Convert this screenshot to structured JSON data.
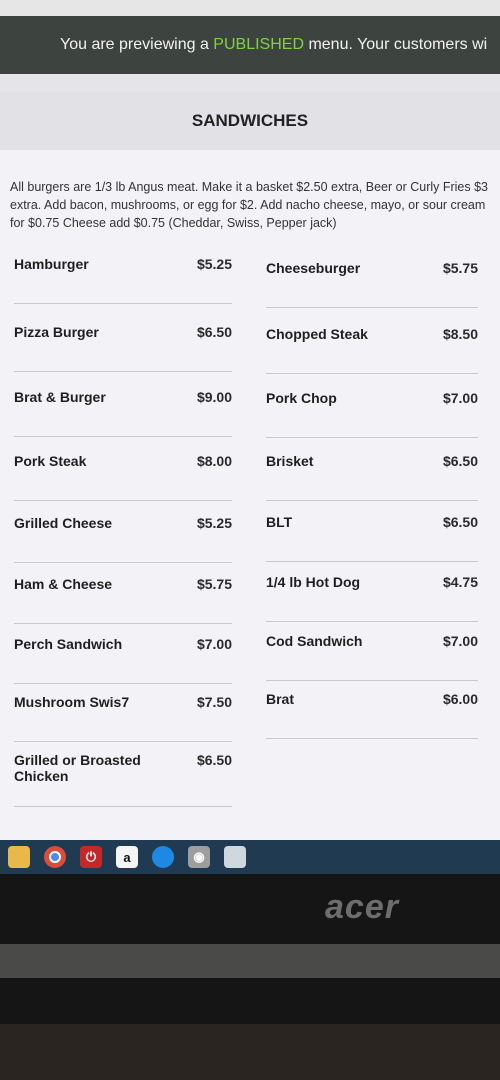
{
  "banner": {
    "prefix": "You are previewing a ",
    "highlight": "PUBLISHED",
    "suffix": " menu. Your customers wi"
  },
  "section": {
    "title": "SANDWICHES",
    "description": "All burgers are 1/3 lb Angus meat. Make it a basket $2.50 extra, Beer or Curly Fries $3 extra. Add bacon, mushrooms, or egg for $2. Add nacho cheese, mayo, or sour cream for $0.75 Cheese add $0.75 (Cheddar, Swiss, Pepper jack)"
  },
  "items": [
    {
      "name": "Hamburger",
      "price": "$5.25"
    },
    {
      "name": "Cheeseburger",
      "price": "$5.75"
    },
    {
      "name": "Pizza Burger",
      "price": "$6.50"
    },
    {
      "name": "Chopped Steak",
      "price": "$8.50"
    },
    {
      "name": "Brat & Burger",
      "price": "$9.00"
    },
    {
      "name": "Pork Chop",
      "price": "$7.00"
    },
    {
      "name": "Pork Steak",
      "price": "$8.00"
    },
    {
      "name": "Brisket",
      "price": "$6.50"
    },
    {
      "name": "Grilled Cheese",
      "price": "$5.25"
    },
    {
      "name": "BLT",
      "price": "$6.50"
    },
    {
      "name": "Ham & Cheese",
      "price": "$5.75"
    },
    {
      "name": "1/4 lb Hot Dog",
      "price": "$4.75"
    },
    {
      "name": "Perch Sandwich",
      "price": "$7.00"
    },
    {
      "name": "Cod Sandwich",
      "price": "$7.00"
    },
    {
      "name": "Mushroom Swis7",
      "price": "$7.50"
    },
    {
      "name": "Brat",
      "price": "$6.00"
    },
    {
      "name": "Grilled or Broasted Chicken",
      "price": "$6.50"
    }
  ],
  "taskbar": {
    "icons": [
      "file-explorer-icon",
      "chrome-icon",
      "power-app-icon",
      "amazon-icon",
      "edge-icon",
      "camera-icon",
      "cloud-app-icon"
    ],
    "amazon_letter": "a"
  },
  "monitor": {
    "brand": "acer"
  }
}
